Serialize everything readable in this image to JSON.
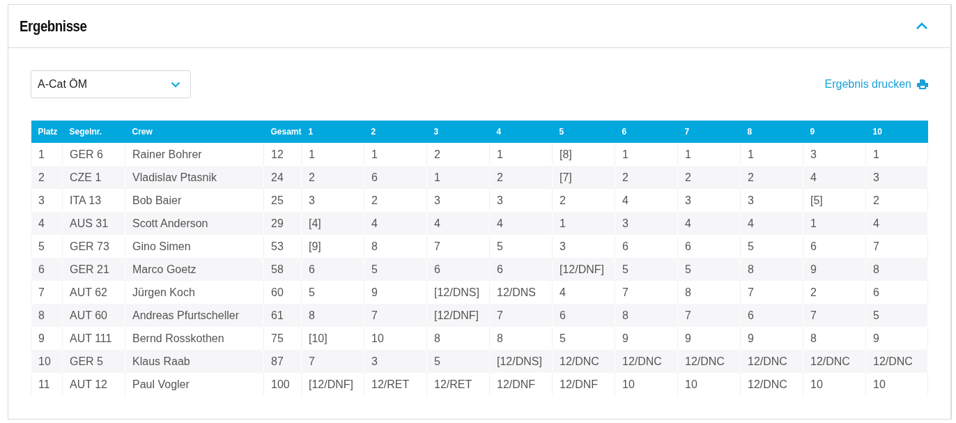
{
  "panel": {
    "title": "Ergebnisse",
    "expanded": true
  },
  "class_select": {
    "value": "A-Cat ÖM"
  },
  "print_link": {
    "label": "Ergebnis drucken"
  },
  "table": {
    "columns": [
      "Platz",
      "Segelnr.",
      "Crew",
      "Gesamt",
      "1",
      "2",
      "3",
      "4",
      "5",
      "6",
      "7",
      "8",
      "9",
      "10"
    ],
    "rows": [
      [
        "1",
        "GER 6",
        "Rainer Bohrer",
        "12",
        "1",
        "1",
        "2",
        "1",
        "[8]",
        "1",
        "1",
        "1",
        "3",
        "1"
      ],
      [
        "2",
        "CZE 1",
        "Vladislav Ptasnik",
        "24",
        "2",
        "6",
        "1",
        "2",
        "[7]",
        "2",
        "2",
        "2",
        "4",
        "3"
      ],
      [
        "3",
        "ITA 13",
        "Bob Baier",
        "25",
        "3",
        "2",
        "3",
        "3",
        "2",
        "4",
        "3",
        "3",
        "[5]",
        "2"
      ],
      [
        "4",
        "AUS 31",
        "Scott Anderson",
        "29",
        "[4]",
        "4",
        "4",
        "4",
        "1",
        "3",
        "4",
        "4",
        "1",
        "4"
      ],
      [
        "5",
        "GER 73",
        "Gino Simen",
        "53",
        "[9]",
        "8",
        "7",
        "5",
        "3",
        "6",
        "6",
        "5",
        "6",
        "7"
      ],
      [
        "6",
        "GER 21",
        "Marco Goetz",
        "58",
        "6",
        "5",
        "6",
        "6",
        "[12/DNF]",
        "5",
        "5",
        "8",
        "9",
        "8"
      ],
      [
        "7",
        "AUT 62",
        "Jürgen Koch",
        "60",
        "5",
        "9",
        "[12/DNS]",
        "12/DNS",
        "4",
        "7",
        "8",
        "7",
        "2",
        "6"
      ],
      [
        "8",
        "AUT 60",
        "Andreas Pfurtscheller",
        "61",
        "8",
        "7",
        "[12/DNF]",
        "7",
        "6",
        "8",
        "7",
        "6",
        "7",
        "5"
      ],
      [
        "9",
        "AUT 111",
        "Bernd Rosskothen",
        "75",
        "[10]",
        "10",
        "8",
        "8",
        "5",
        "9",
        "9",
        "9",
        "8",
        "9"
      ],
      [
        "10",
        "GER 5",
        "Klaus Raab",
        "87",
        "7",
        "3",
        "5",
        "[12/DNS]",
        "12/DNC",
        "12/DNC",
        "12/DNC",
        "12/DNC",
        "12/DNC",
        "12/DNC"
      ],
      [
        "11",
        "AUT 12",
        "Paul Vogler",
        "100",
        "[12/DNF]",
        "12/RET",
        "12/RET",
        "12/DNF",
        "12/DNF",
        "10",
        "10",
        "12/DNC",
        "10",
        "10"
      ]
    ]
  }
}
